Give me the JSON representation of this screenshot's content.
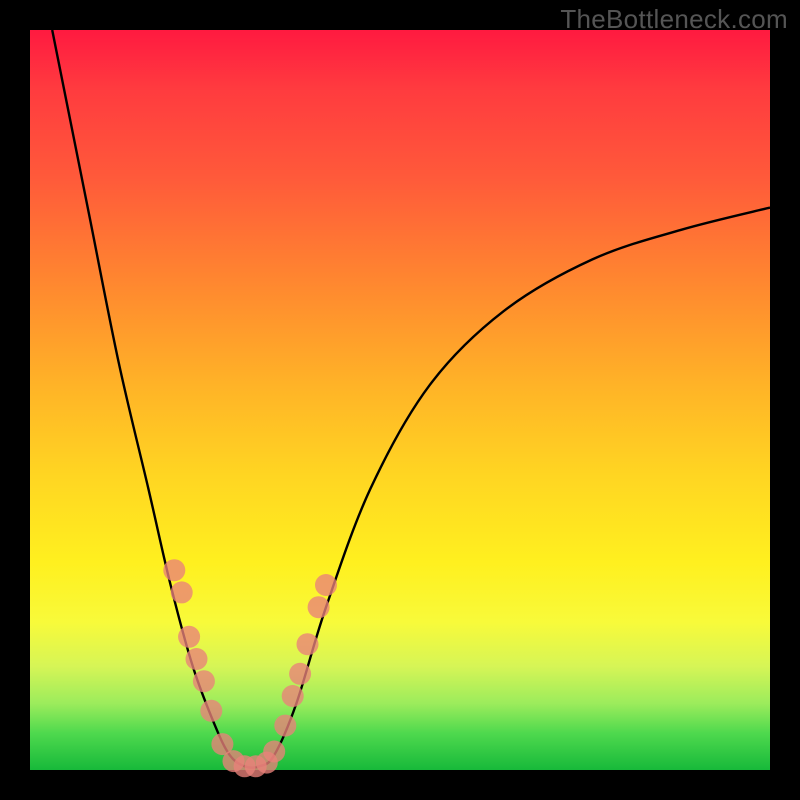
{
  "watermark": "TheBottleneck.com",
  "chart_data": {
    "type": "line",
    "title": "",
    "xlabel": "",
    "ylabel": "",
    "xlim": [
      0,
      100
    ],
    "ylim": [
      0,
      100
    ],
    "grid": false,
    "series": [
      {
        "name": "bottleneck-curve",
        "color": "#000000",
        "points": [
          {
            "x": 3,
            "y": 100
          },
          {
            "x": 5,
            "y": 90
          },
          {
            "x": 8,
            "y": 75
          },
          {
            "x": 12,
            "y": 55
          },
          {
            "x": 16,
            "y": 38
          },
          {
            "x": 19,
            "y": 25
          },
          {
            "x": 22,
            "y": 14
          },
          {
            "x": 25,
            "y": 6
          },
          {
            "x": 27,
            "y": 2
          },
          {
            "x": 29,
            "y": 0.5
          },
          {
            "x": 31,
            "y": 0.5
          },
          {
            "x": 33,
            "y": 2
          },
          {
            "x": 36,
            "y": 9
          },
          {
            "x": 40,
            "y": 22
          },
          {
            "x": 46,
            "y": 38
          },
          {
            "x": 54,
            "y": 52
          },
          {
            "x": 64,
            "y": 62
          },
          {
            "x": 76,
            "y": 69
          },
          {
            "x": 88,
            "y": 73
          },
          {
            "x": 100,
            "y": 76
          }
        ]
      }
    ],
    "scatter": {
      "name": "sample-dots",
      "color": "#e9827a",
      "radius": 11,
      "points": [
        {
          "x": 19.5,
          "y": 27
        },
        {
          "x": 20.5,
          "y": 24
        },
        {
          "x": 21.5,
          "y": 18
        },
        {
          "x": 22.5,
          "y": 15
        },
        {
          "x": 23.5,
          "y": 12
        },
        {
          "x": 24.5,
          "y": 8
        },
        {
          "x": 26,
          "y": 3.5
        },
        {
          "x": 27.5,
          "y": 1.2
        },
        {
          "x": 29,
          "y": 0.5
        },
        {
          "x": 30.5,
          "y": 0.5
        },
        {
          "x": 32,
          "y": 1
        },
        {
          "x": 33,
          "y": 2.5
        },
        {
          "x": 34.5,
          "y": 6
        },
        {
          "x": 35.5,
          "y": 10
        },
        {
          "x": 36.5,
          "y": 13
        },
        {
          "x": 37.5,
          "y": 17
        },
        {
          "x": 39,
          "y": 22
        },
        {
          "x": 40,
          "y": 25
        }
      ]
    }
  }
}
